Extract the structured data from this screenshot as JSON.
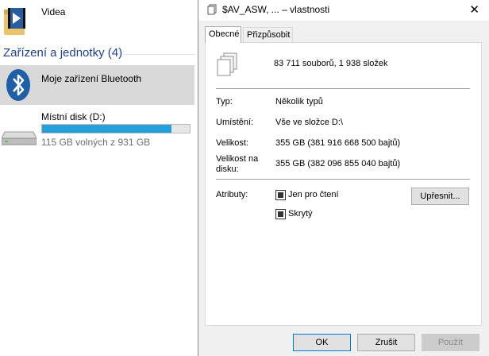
{
  "explorer": {
    "folder_name": "Videa",
    "group_header": "Zařízení a jednotky (4)",
    "bluetooth_label": "Moje zařízení Bluetooth",
    "disk": {
      "name": "Místní disk (D:)",
      "free_text": "115 GB volných z 931 GB",
      "used_fraction": 0.876
    }
  },
  "dialog": {
    "title": "$AV_ASW, ... – vlastnosti",
    "tabs": [
      {
        "label": "Obecné",
        "active": true
      },
      {
        "label": "Přizpůsobit",
        "active": false
      }
    ],
    "summary": "83 711 souborů, 1 938 složek",
    "fields": {
      "type_label": "Typ:",
      "type_value": "Několik typů",
      "location_label": "Umístění:",
      "location_value": "Vše ve složce D:\\",
      "size_label": "Velikost:",
      "size_value": "355 GB (381 916 668 500 bajtů)",
      "disk_size_label_1": "Velikost na",
      "disk_size_label_2": "disku:",
      "disk_size_value": "355 GB (382 096 855 040 bajtů)",
      "attributes_label": "Atributy:",
      "readonly_label": "Jen pro čtení",
      "hidden_label": "Skrytý",
      "advanced_button": "Upřesnit..."
    },
    "buttons": {
      "ok": "OK",
      "cancel": "Zrušit",
      "apply": "Použít"
    }
  }
}
